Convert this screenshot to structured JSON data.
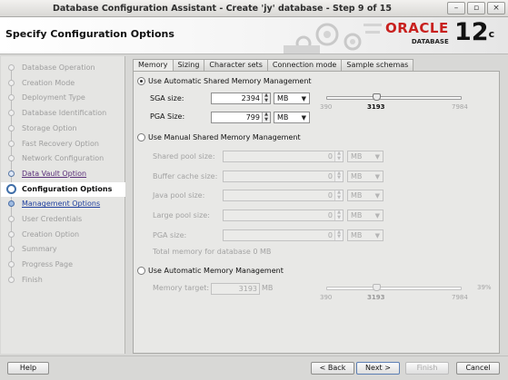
{
  "window": {
    "title": "Database Configuration Assistant - Create 'jy' database - Step 9 of 15",
    "controls": [
      "–",
      "▫",
      "×"
    ]
  },
  "header": {
    "heading": "Specify Configuration Options",
    "brand": "ORACLE",
    "brand_sub": "DATABASE",
    "version": "12",
    "version_sup": "c",
    "brand_color": "#c8201e"
  },
  "nav": {
    "items": [
      {
        "label": "Database Operation",
        "state": "done"
      },
      {
        "label": "Creation Mode",
        "state": "done"
      },
      {
        "label": "Deployment Type",
        "state": "done"
      },
      {
        "label": "Database Identification",
        "state": "done"
      },
      {
        "label": "Storage Option",
        "state": "done"
      },
      {
        "label": "Fast Recovery Option",
        "state": "done"
      },
      {
        "label": "Network Configuration",
        "state": "done"
      },
      {
        "label": "Data Vault Option",
        "state": "link"
      },
      {
        "label": "Configuration Options",
        "state": "current"
      },
      {
        "label": "Management Options",
        "state": "next"
      },
      {
        "label": "User Credentials",
        "state": "pending"
      },
      {
        "label": "Creation Option",
        "state": "pending"
      },
      {
        "label": "Summary",
        "state": "pending"
      },
      {
        "label": "Progress Page",
        "state": "pending"
      },
      {
        "label": "Finish",
        "state": "pending"
      }
    ]
  },
  "tabs": [
    "Memory",
    "Sizing",
    "Character sets",
    "Connection mode",
    "Sample schemas"
  ],
  "active_tab": "Memory",
  "asmm": {
    "label": "Use Automatic Shared Memory Management",
    "selected": true,
    "sga_label": "SGA size:",
    "sga_value": "2394",
    "sga_unit": "MB",
    "pga_label": "PGA Size:",
    "pga_value": "799",
    "pga_unit": "MB",
    "slider": {
      "min": "390",
      "current": "3193",
      "max": "7984"
    }
  },
  "manual": {
    "label": "Use Manual Shared Memory Management",
    "selected": false,
    "fields": [
      {
        "label": "Shared pool size:",
        "value": "0",
        "unit": "MB"
      },
      {
        "label": "Buffer cache size:",
        "value": "0",
        "unit": "MB"
      },
      {
        "label": "Java pool size:",
        "value": "0",
        "unit": "MB"
      },
      {
        "label": "Large pool size:",
        "value": "0",
        "unit": "MB"
      },
      {
        "label": "PGA size:",
        "value": "0",
        "unit": "MB"
      }
    ],
    "total": "Total memory for database 0 MB"
  },
  "amm": {
    "label": "Use Automatic Memory Management",
    "selected": false,
    "target_label": "Memory target:",
    "target_value": "3193",
    "target_unit": "MB",
    "percent": "39%",
    "slider": {
      "min": "390",
      "current": "3193",
      "max": "7984"
    }
  },
  "footer": {
    "help": "Help",
    "back": "< Back",
    "next": "Next >",
    "finish": "Finish",
    "cancel": "Cancel"
  }
}
